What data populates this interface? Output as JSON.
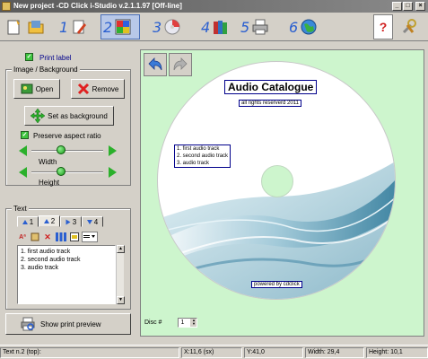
{
  "window": {
    "title": "New project -CD Click i-Studio v.2.1.1.97 [Off-line]"
  },
  "toolbar": {
    "steps": [
      {
        "num": "1",
        "icon": "edit-icon"
      },
      {
        "num": "2",
        "icon": "palette-icon"
      },
      {
        "num": "3",
        "icon": "cd-icon"
      },
      {
        "num": "4",
        "icon": "books-icon"
      },
      {
        "num": "5",
        "icon": "printer-icon"
      },
      {
        "num": "6",
        "icon": "globe-icon"
      }
    ],
    "active_step": "2",
    "help_label": "?"
  },
  "left": {
    "print_label": "Print label",
    "image_group_title": "Image / Background",
    "open_label": "Open",
    "remove_label": "Remove",
    "set_bg_label": "Set as background",
    "preserve_label": "Preserve aspect ratio",
    "width_label": "Width",
    "height_label": "Height",
    "width_level": 0.4,
    "height_level": 0.4,
    "text_group_title": "Text",
    "tabs": [
      "1",
      "2",
      "3",
      "4"
    ],
    "active_tab": "2",
    "text_lines": [
      "1. first audio track",
      "2. second audio track",
      "3. audio track"
    ],
    "preview_label": "Show print preview"
  },
  "disc": {
    "title": "Audio Catalogue",
    "subtitle": "all rights reserverd 2011",
    "tracks": [
      "1. first audio track",
      "2. second audio track",
      "3. audio track"
    ],
    "footer": "powered by cdclick",
    "counter_label": "Disc #",
    "counter_value": "1"
  },
  "status": {
    "text_info": "Text n.2 (top):",
    "x": "X:11,6 (sx)",
    "y": "Y:41,0",
    "width": "Width: 29,4",
    "height": "Height: 10,1"
  },
  "colors": {
    "canvas_bg": "#cdf5cd",
    "step_number": "#2a5fd0",
    "label_border": "#00008b"
  }
}
